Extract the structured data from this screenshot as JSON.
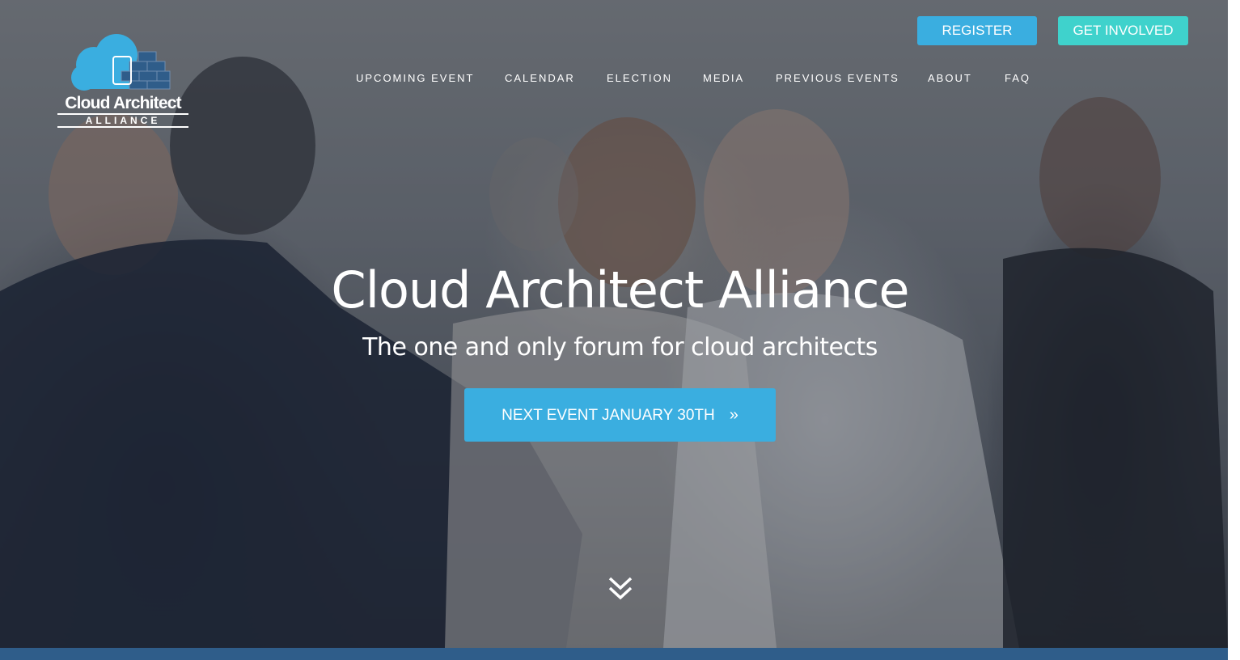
{
  "logo": {
    "line1": "Cloud Architect",
    "line2": "ALLIANCE"
  },
  "top_buttons": {
    "register": "REGISTER",
    "get_involved": "GET INVOLVED"
  },
  "nav": [
    {
      "label": "UPCOMING EVENT"
    },
    {
      "label": "CALENDAR"
    },
    {
      "label": "ELECTION"
    },
    {
      "label": "MEDIA"
    },
    {
      "label": "PREVIOUS EVENTS"
    },
    {
      "label": "ABOUT"
    },
    {
      "label": "FAQ"
    }
  ],
  "hero": {
    "title": "Cloud Architect Alliance",
    "subtitle": "The one and only forum for cloud architects",
    "cta_label": "NEXT EVENT JANUARY 30TH",
    "cta_icon": "double-chevron-right-icon",
    "scroll_icon": "double-chevron-down-icon"
  },
  "colors": {
    "register_button": "#3aaee0",
    "get_involved_button": "#3fd2cc",
    "cta_button": "#3aaee0",
    "bottom_strip": "#2f5d8a",
    "logo_cloud": "#3aaee0",
    "logo_bricks": "#2f5d8a"
  }
}
